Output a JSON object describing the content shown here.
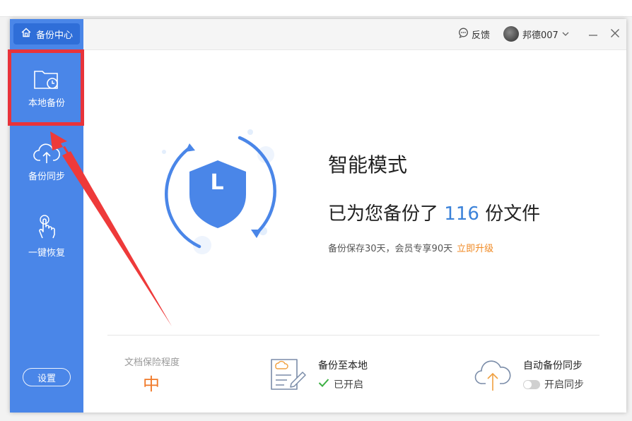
{
  "sidebar": {
    "home_label": "备份中心",
    "items": [
      {
        "label": "本地备份",
        "icon": "folder-clock-icon"
      },
      {
        "label": "备份同步",
        "icon": "cloud-upload-icon"
      },
      {
        "label": "一键恢复",
        "icon": "hand-tap-icon"
      }
    ],
    "settings_label": "设置"
  },
  "titlebar": {
    "feedback_label": "反馈",
    "username": "邦德007"
  },
  "hero": {
    "shield_letter": "L",
    "mode_title": "智能模式",
    "backup_prefix": "已为您备份了",
    "backup_count": "116",
    "backup_suffix": "份文件",
    "retention_text": "备份保存30天，会员专享90天",
    "upgrade_link": "立即升级"
  },
  "footer": {
    "risk_label": "文档保险程度",
    "risk_value": "中",
    "local_title": "备份至本地",
    "local_status": "已开启",
    "sync_title": "自动备份同步",
    "sync_status": "开启同步"
  },
  "colors": {
    "sidebar": "#4a86e8",
    "accent_blue": "#3b82d9",
    "upgrade_orange": "#f08a24",
    "risk_orange": "#f07a2a",
    "highlight_red": "#e8333a"
  }
}
